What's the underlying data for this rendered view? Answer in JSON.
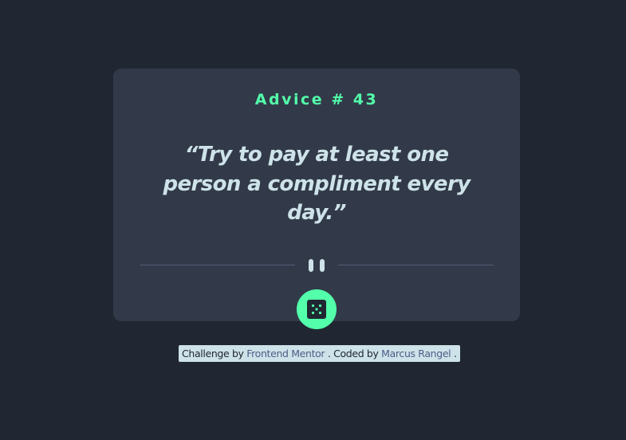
{
  "card": {
    "advice_label": "Advice # 43",
    "quote": "“Try to pay at least one person a compliment every day.”"
  },
  "icons": {
    "divider": "pause-icon",
    "button": "dice-icon"
  },
  "attribution": {
    "prefix": "Challenge by",
    "link1": "Frontend Mentor",
    "middle": ". Coded by",
    "link2": "Marcus Rangel",
    "suffix": "."
  },
  "colors": {
    "background": "#202632",
    "card": "#323a49",
    "accent": "#53ffaa",
    "text": "#cee3e9",
    "divider": "#4f5d74",
    "link": "#4c5d87"
  }
}
